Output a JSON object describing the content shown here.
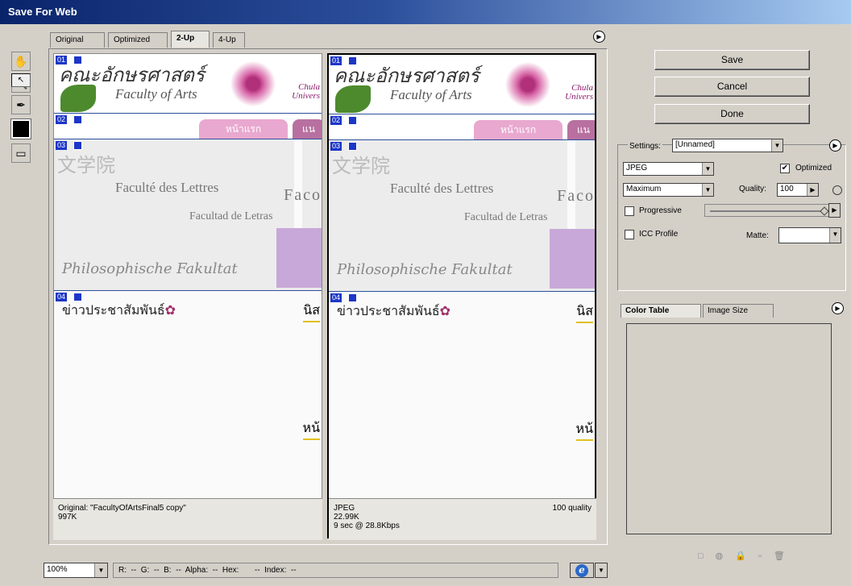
{
  "window": {
    "title": "Save For Web"
  },
  "view_tabs": [
    "Original",
    "Optimized",
    "2-Up",
    "4-Up"
  ],
  "active_view_tab": "2-Up",
  "slices": [
    "01",
    "02",
    "03",
    "04"
  ],
  "preview": {
    "thai_title": "คณะอักษรศาสตร์",
    "faculty_en": "Faculty of Arts",
    "chula": "Chula\nUnivers",
    "nav_home": "หน้าแรก",
    "nav_2": "แน",
    "cjk": "文学院",
    "french": "Faculté des Lettres",
    "spanish": "Facultad de Letras",
    "faco": "Faco",
    "german": "Philosophische Fakultat",
    "news": "ข่าวประชาสัมพันธ์",
    "nil": "นิส",
    "nhu": "หน้"
  },
  "original_info": {
    "line1": "Original: \"FacultyOfArtsFinal5 copy\"",
    "line2": "997K"
  },
  "optimized_info": {
    "format": "JPEG",
    "quality": "100 quality",
    "size": "22.99K",
    "time": "9 sec @ 28.8Kbps"
  },
  "buttons": {
    "save": "Save",
    "cancel": "Cancel",
    "done": "Done"
  },
  "settings": {
    "label": "Settings:",
    "value": "[Unnamed]",
    "format": "JPEG",
    "optimized_label": "Optimized",
    "optimized": true,
    "quality_preset": "Maximum",
    "quality_label": "Quality:",
    "quality_value": "100",
    "progressive_label": "Progressive",
    "progressive": false,
    "icc_label": "ICC Profile",
    "icc": false,
    "matte_label": "Matte:",
    "matte_value": ""
  },
  "color_tabs": [
    "Color Table",
    "Image Size"
  ],
  "status": {
    "zoom": "100%",
    "readout": "R:  --  G:  --  B:  --  Alpha:  --  Hex:       --  Index:  --"
  }
}
